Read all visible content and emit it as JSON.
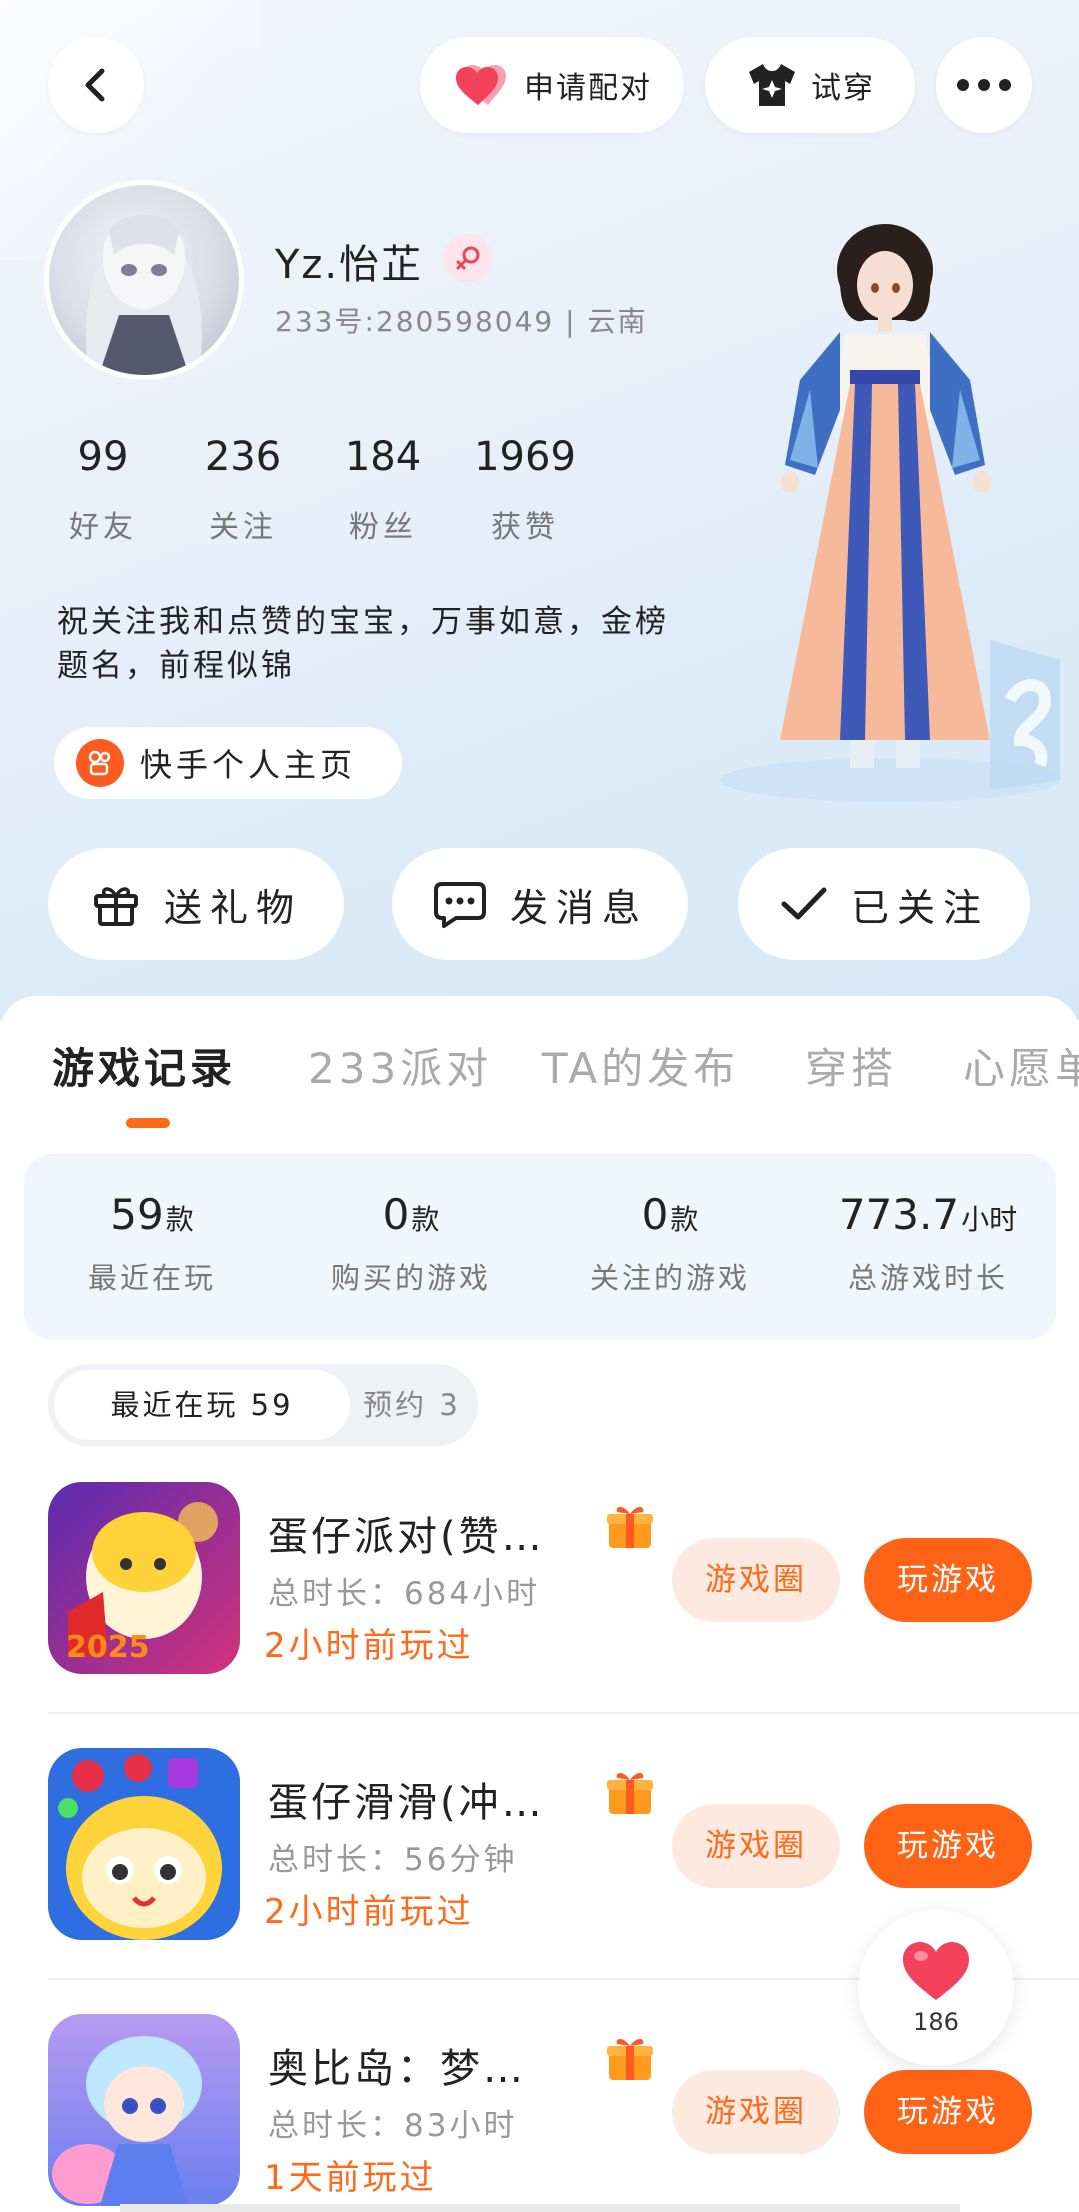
{
  "header": {
    "match_label": "申请配对",
    "try_on_label": "试穿"
  },
  "profile": {
    "username": "Yz.怡芷",
    "id_line": "233号:280598049 | 云南",
    "bio": "祝关注我和点赞的宝宝，万事如意，金榜题名，前程似锦",
    "kuaishou_link": "快手个人主页",
    "stats": [
      {
        "value": "99",
        "label": "好友"
      },
      {
        "value": "236",
        "label": "关注"
      },
      {
        "value": "184",
        "label": "粉丝"
      },
      {
        "value": "1969",
        "label": "获赞"
      }
    ]
  },
  "actions": {
    "gift": "送礼物",
    "message": "发消息",
    "follow": "已关注"
  },
  "tabs": [
    "游戏记录",
    "233派对",
    "TA的发布",
    "穿搭",
    "心愿单"
  ],
  "game_stats": [
    {
      "value": "59",
      "unit": "款",
      "label": "最近在玩"
    },
    {
      "value": "0",
      "unit": "款",
      "label": "购买的游戏"
    },
    {
      "value": "0",
      "unit": "款",
      "label": "关注的游戏"
    },
    {
      "value": "773.7",
      "unit": "小时",
      "label": "总游戏时长"
    }
  ],
  "filters": {
    "recent": "最近在玩 59",
    "reserved": "预约 3"
  },
  "games": [
    {
      "title": "蛋仔派对(赞…",
      "duration": "总时长：684小时",
      "last_played": "2小时前玩过",
      "circle_label": "游戏圈",
      "play_label": "玩游戏",
      "icon_year": "2025"
    },
    {
      "title": "蛋仔滑滑(冲…",
      "duration": "总时长：56分钟",
      "last_played": "2小时前玩过",
      "circle_label": "游戏圈",
      "play_label": "玩游戏"
    },
    {
      "title": "奥比岛：梦…",
      "duration": "总时长：83小时",
      "last_played": "1天前玩过",
      "circle_label": "游戏圈",
      "play_label": "玩游戏"
    }
  ],
  "like_float": {
    "count": "186"
  },
  "colors": {
    "accent": "#ff6315",
    "accent_soft": "#fde9df",
    "heart": "#f2415b"
  }
}
